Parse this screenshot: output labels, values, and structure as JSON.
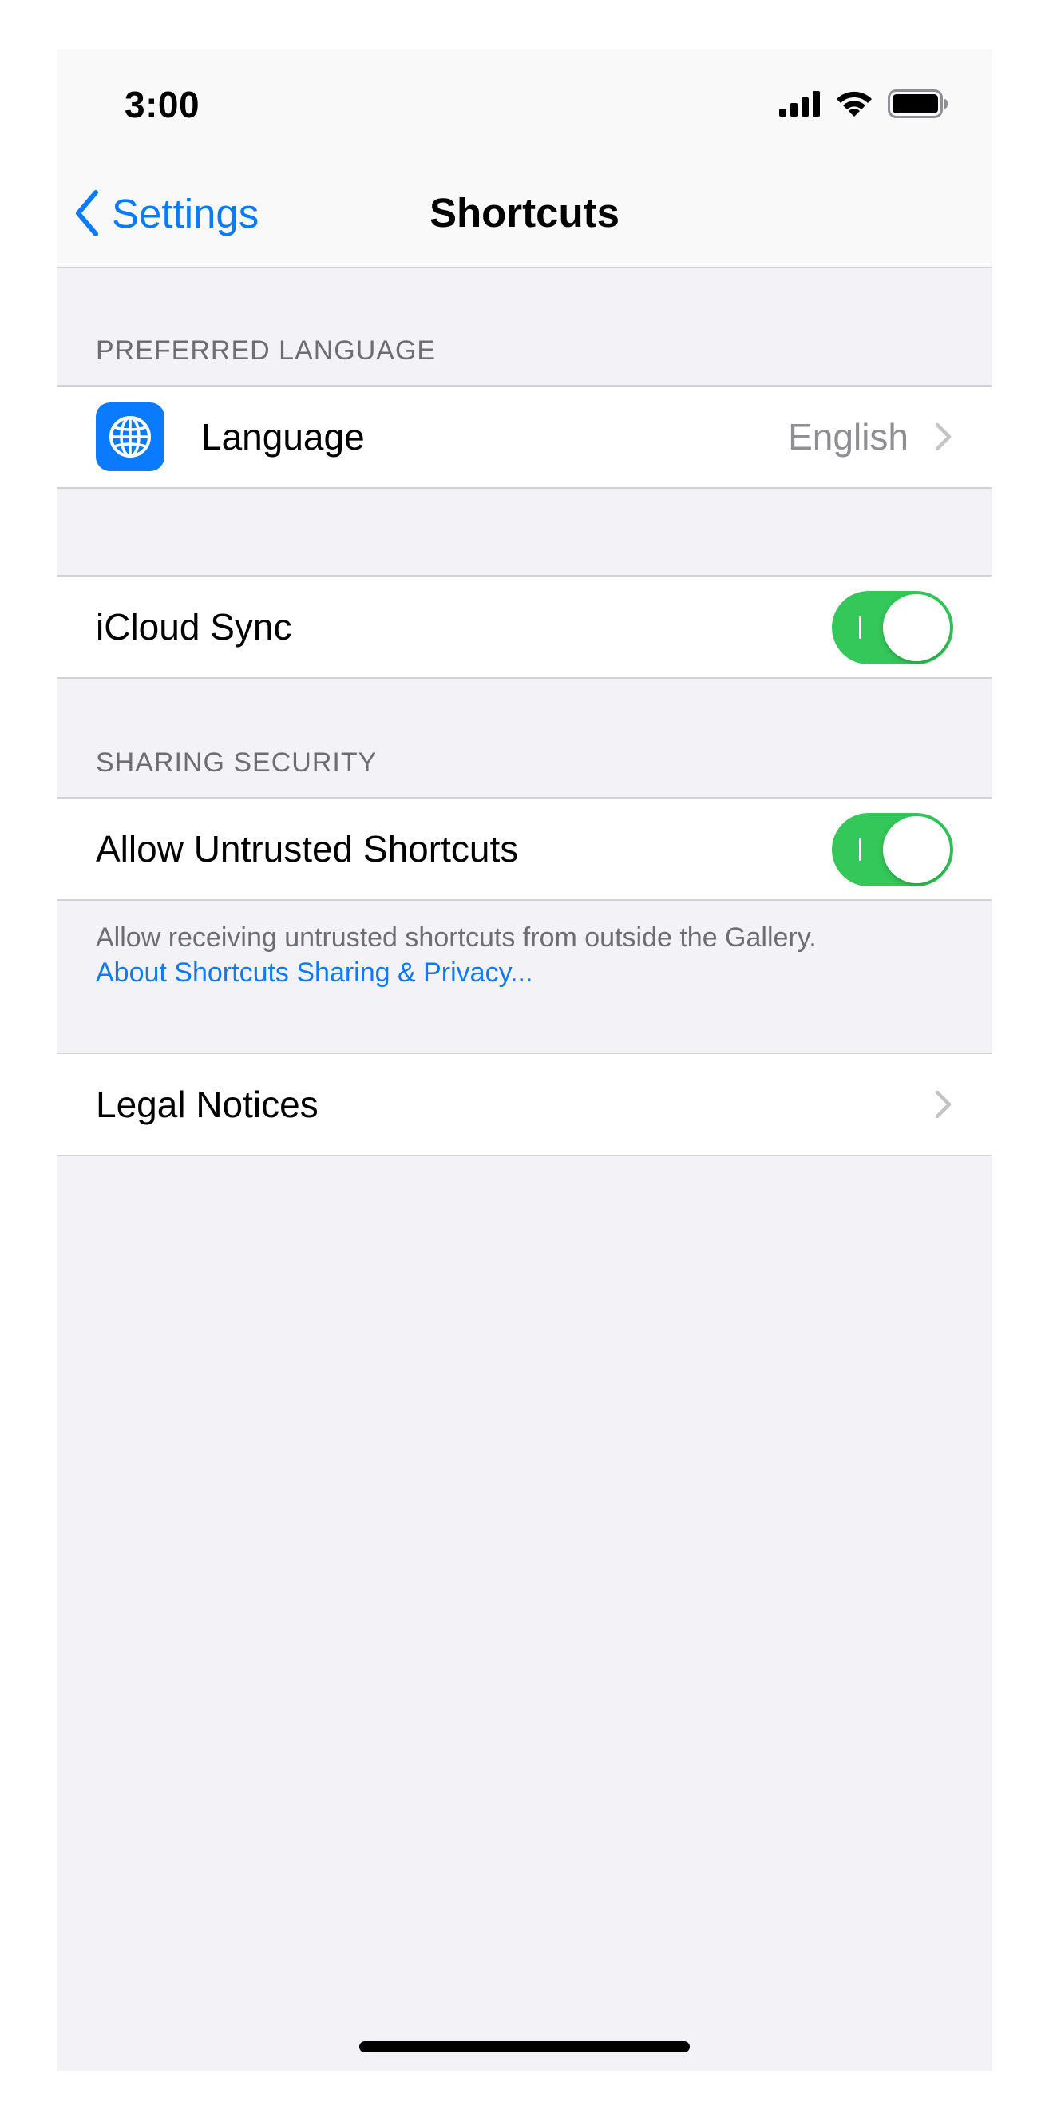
{
  "status_bar": {
    "time": "3:00",
    "icons": [
      "signal-icon",
      "wifi-icon",
      "battery-icon"
    ]
  },
  "nav": {
    "back_label": "Settings",
    "title": "Shortcuts"
  },
  "sections": {
    "preferred_language": {
      "header": "PREFERRED LANGUAGE",
      "language_label": "Language",
      "language_value": "English",
      "icon": "globe-icon"
    },
    "icloud": {
      "label": "iCloud Sync",
      "enabled": true
    },
    "sharing_security": {
      "header": "SHARING SECURITY",
      "label": "Allow Untrusted Shortcuts",
      "enabled": true,
      "footer_text": "Allow receiving untrusted shortcuts from outside the Gallery.",
      "footer_link": "About Shortcuts Sharing & Privacy..."
    },
    "legal": {
      "label": "Legal Notices"
    }
  },
  "colors": {
    "accent": "#0a7aff",
    "toggle_on": "#34c759",
    "background": "#f2f2f7",
    "secondary_text": "#6d6d72"
  }
}
